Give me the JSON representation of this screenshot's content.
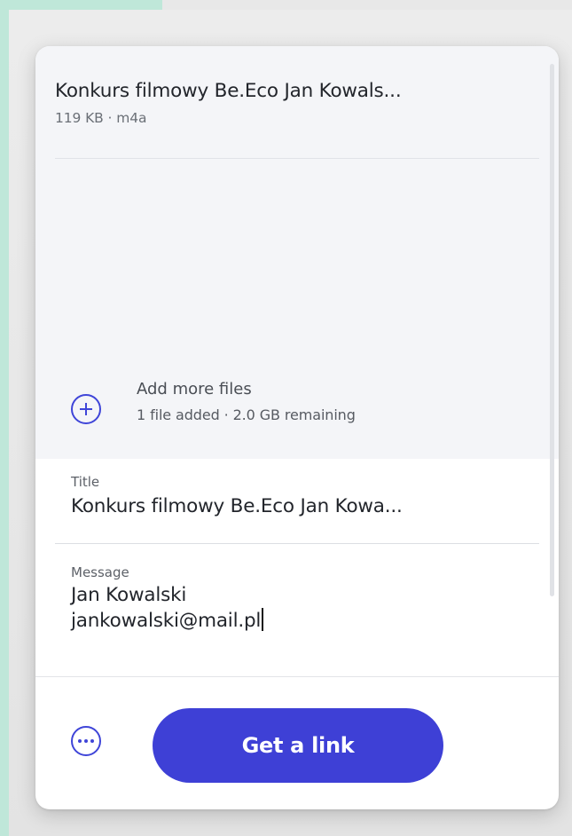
{
  "file": {
    "name": "Konkurs filmowy Be.Eco Jan Kowals...",
    "meta": "119 KB · m4a"
  },
  "add_files": {
    "label": "Add more files",
    "status": "1 file added · 2.0 GB remaining",
    "icon": "plus-circle-icon"
  },
  "title_field": {
    "label": "Title",
    "value": "Konkurs filmowy Be.Eco Jan Kowa..."
  },
  "message_field": {
    "label": "Message",
    "lines": [
      "Jan Kowalski",
      "jankowalski@mail.pl"
    ]
  },
  "footer": {
    "more_icon": "more-horizontal-circle-icon",
    "link_button_label": "Get a link"
  },
  "colors": {
    "accent": "#3e40d6",
    "files_background": "#f4f5f8",
    "page_mint": "#bfe7d9"
  }
}
